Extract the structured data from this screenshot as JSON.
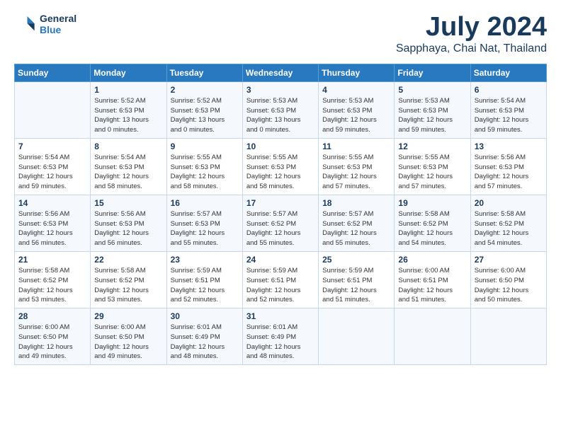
{
  "logo": {
    "line1": "General",
    "line2": "Blue"
  },
  "title": "July 2024",
  "location": "Sapphaya, Chai Nat, Thailand",
  "headers": [
    "Sunday",
    "Monday",
    "Tuesday",
    "Wednesday",
    "Thursday",
    "Friday",
    "Saturday"
  ],
  "weeks": [
    [
      {
        "day": "",
        "info": ""
      },
      {
        "day": "1",
        "info": "Sunrise: 5:52 AM\nSunset: 6:53 PM\nDaylight: 13 hours\nand 0 minutes."
      },
      {
        "day": "2",
        "info": "Sunrise: 5:52 AM\nSunset: 6:53 PM\nDaylight: 13 hours\nand 0 minutes."
      },
      {
        "day": "3",
        "info": "Sunrise: 5:53 AM\nSunset: 6:53 PM\nDaylight: 13 hours\nand 0 minutes."
      },
      {
        "day": "4",
        "info": "Sunrise: 5:53 AM\nSunset: 6:53 PM\nDaylight: 12 hours\nand 59 minutes."
      },
      {
        "day": "5",
        "info": "Sunrise: 5:53 AM\nSunset: 6:53 PM\nDaylight: 12 hours\nand 59 minutes."
      },
      {
        "day": "6",
        "info": "Sunrise: 5:54 AM\nSunset: 6:53 PM\nDaylight: 12 hours\nand 59 minutes."
      }
    ],
    [
      {
        "day": "7",
        "info": "Sunrise: 5:54 AM\nSunset: 6:53 PM\nDaylight: 12 hours\nand 59 minutes."
      },
      {
        "day": "8",
        "info": "Sunrise: 5:54 AM\nSunset: 6:53 PM\nDaylight: 12 hours\nand 58 minutes."
      },
      {
        "day": "9",
        "info": "Sunrise: 5:55 AM\nSunset: 6:53 PM\nDaylight: 12 hours\nand 58 minutes."
      },
      {
        "day": "10",
        "info": "Sunrise: 5:55 AM\nSunset: 6:53 PM\nDaylight: 12 hours\nand 58 minutes."
      },
      {
        "day": "11",
        "info": "Sunrise: 5:55 AM\nSunset: 6:53 PM\nDaylight: 12 hours\nand 57 minutes."
      },
      {
        "day": "12",
        "info": "Sunrise: 5:55 AM\nSunset: 6:53 PM\nDaylight: 12 hours\nand 57 minutes."
      },
      {
        "day": "13",
        "info": "Sunrise: 5:56 AM\nSunset: 6:53 PM\nDaylight: 12 hours\nand 57 minutes."
      }
    ],
    [
      {
        "day": "14",
        "info": "Sunrise: 5:56 AM\nSunset: 6:53 PM\nDaylight: 12 hours\nand 56 minutes."
      },
      {
        "day": "15",
        "info": "Sunrise: 5:56 AM\nSunset: 6:53 PM\nDaylight: 12 hours\nand 56 minutes."
      },
      {
        "day": "16",
        "info": "Sunrise: 5:57 AM\nSunset: 6:53 PM\nDaylight: 12 hours\nand 55 minutes."
      },
      {
        "day": "17",
        "info": "Sunrise: 5:57 AM\nSunset: 6:52 PM\nDaylight: 12 hours\nand 55 minutes."
      },
      {
        "day": "18",
        "info": "Sunrise: 5:57 AM\nSunset: 6:52 PM\nDaylight: 12 hours\nand 55 minutes."
      },
      {
        "day": "19",
        "info": "Sunrise: 5:58 AM\nSunset: 6:52 PM\nDaylight: 12 hours\nand 54 minutes."
      },
      {
        "day": "20",
        "info": "Sunrise: 5:58 AM\nSunset: 6:52 PM\nDaylight: 12 hours\nand 54 minutes."
      }
    ],
    [
      {
        "day": "21",
        "info": "Sunrise: 5:58 AM\nSunset: 6:52 PM\nDaylight: 12 hours\nand 53 minutes."
      },
      {
        "day": "22",
        "info": "Sunrise: 5:58 AM\nSunset: 6:52 PM\nDaylight: 12 hours\nand 53 minutes."
      },
      {
        "day": "23",
        "info": "Sunrise: 5:59 AM\nSunset: 6:51 PM\nDaylight: 12 hours\nand 52 minutes."
      },
      {
        "day": "24",
        "info": "Sunrise: 5:59 AM\nSunset: 6:51 PM\nDaylight: 12 hours\nand 52 minutes."
      },
      {
        "day": "25",
        "info": "Sunrise: 5:59 AM\nSunset: 6:51 PM\nDaylight: 12 hours\nand 51 minutes."
      },
      {
        "day": "26",
        "info": "Sunrise: 6:00 AM\nSunset: 6:51 PM\nDaylight: 12 hours\nand 51 minutes."
      },
      {
        "day": "27",
        "info": "Sunrise: 6:00 AM\nSunset: 6:50 PM\nDaylight: 12 hours\nand 50 minutes."
      }
    ],
    [
      {
        "day": "28",
        "info": "Sunrise: 6:00 AM\nSunset: 6:50 PM\nDaylight: 12 hours\nand 49 minutes."
      },
      {
        "day": "29",
        "info": "Sunrise: 6:00 AM\nSunset: 6:50 PM\nDaylight: 12 hours\nand 49 minutes."
      },
      {
        "day": "30",
        "info": "Sunrise: 6:01 AM\nSunset: 6:49 PM\nDaylight: 12 hours\nand 48 minutes."
      },
      {
        "day": "31",
        "info": "Sunrise: 6:01 AM\nSunset: 6:49 PM\nDaylight: 12 hours\nand 48 minutes."
      },
      {
        "day": "",
        "info": ""
      },
      {
        "day": "",
        "info": ""
      },
      {
        "day": "",
        "info": ""
      }
    ]
  ]
}
